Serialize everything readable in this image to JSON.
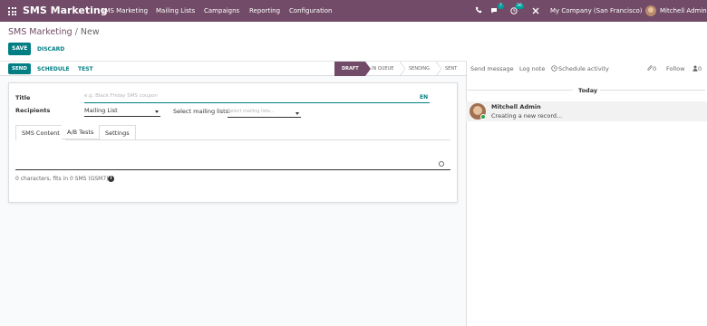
{
  "navbar": {
    "app_name": "SMS Marketing",
    "menu": [
      "SMS Marketing",
      "Mailing Lists",
      "Campaigns",
      "Reporting",
      "Configuration"
    ],
    "messages_count": "7",
    "activities_count": "36",
    "company": "My Company (San Francisco)",
    "user": "Mitchell Admin"
  },
  "breadcrumb": {
    "parent": "SMS Marketing",
    "separator": "/",
    "current": "New"
  },
  "actions": {
    "save": "SAVE",
    "discard": "DISCARD"
  },
  "header_buttons": {
    "send": "SEND",
    "schedule": "SCHEDULE",
    "test": "TEST"
  },
  "statusbar": {
    "steps": [
      "DRAFT",
      "IN QUEUE",
      "SENDING",
      "SENT"
    ],
    "active": "DRAFT"
  },
  "form": {
    "title_label": "Title",
    "title_placeholder": "e.g. Black Friday SMS coupon",
    "lang": "EN",
    "recipients_label": "Recipients",
    "recipients_value": "Mailing List",
    "mailing_lists_label": "Select mailing lists:",
    "mailing_lists_placeholder": "Select mailing lists...",
    "tabs": [
      "SMS Content",
      "A/B Tests",
      "Settings"
    ],
    "active_tab": "SMS Content",
    "sms_info": "0 characters, fits in 0 SMS (GSM7)"
  },
  "chatter": {
    "send_message": "Send message",
    "log_note": "Log note",
    "schedule_activity": "Schedule activity",
    "attachments_count": "0",
    "follow": "Follow",
    "followers_count": "0",
    "today": "Today",
    "message": {
      "author": "Mitchell Admin",
      "body": "Creating a new record..."
    }
  },
  "colors": {
    "brand": "#714b67",
    "primary": "#017e84",
    "badge": "#00a09d"
  }
}
